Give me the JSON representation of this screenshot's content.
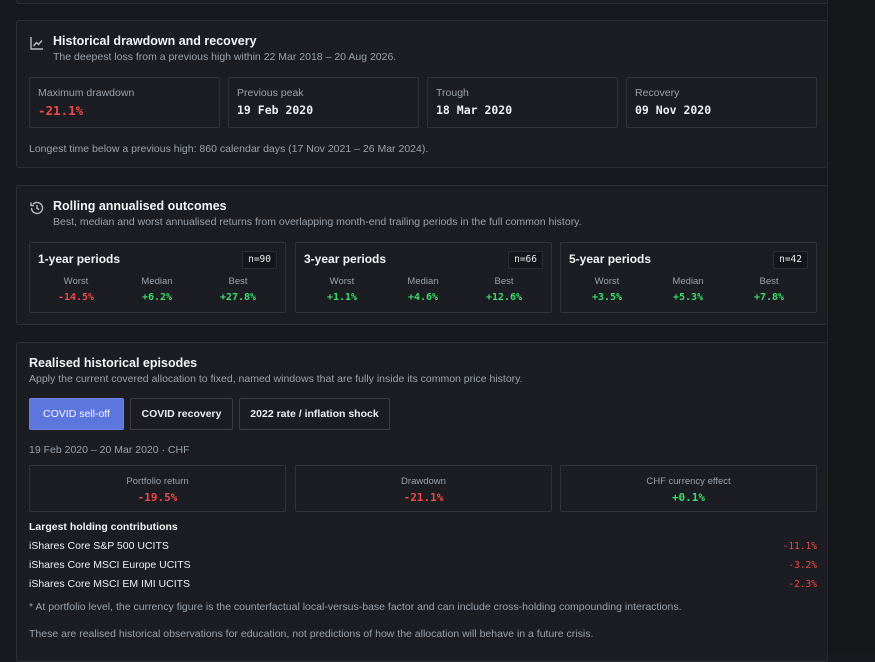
{
  "drawdown": {
    "title": "Historical drawdown and recovery",
    "subtitle": "The deepest loss from a previous high within 22 Mar 2018 – 20 Aug 2026.",
    "stats": [
      {
        "label": "Maximum drawdown",
        "value": "-21.1%"
      },
      {
        "label": "Previous peak",
        "value": "19 Feb 2020"
      },
      {
        "label": "Trough",
        "value": "18 Mar 2020"
      },
      {
        "label": "Recovery",
        "value": "09 Nov 2020"
      }
    ],
    "note": "Longest time below a previous high: 860 calendar days (17 Nov 2021 – 26 Mar 2024)."
  },
  "rolling": {
    "title": "Rolling annualised outcomes",
    "subtitle": "Best, median and worst annualised returns from overlapping month-end trailing periods in the full common history.",
    "col_labels": {
      "worst": "Worst",
      "median": "Median",
      "best": "Best"
    },
    "periods": [
      {
        "title": "1-year periods",
        "n": "n=90",
        "worst": "-14.5%",
        "median": "+6.2%",
        "best": "+27.8%"
      },
      {
        "title": "3-year periods",
        "n": "n=66",
        "worst": "+1.1%",
        "median": "+4.6%",
        "best": "+12.6%"
      },
      {
        "title": "5-year periods",
        "n": "n=42",
        "worst": "+3.5%",
        "median": "+5.3%",
        "best": "+7.8%"
      }
    ]
  },
  "episodes": {
    "title": "Realised historical episodes",
    "subtitle": "Apply the current covered allocation to fixed, named windows that are fully inside its common price history.",
    "buttons": [
      {
        "label": "COVID sell-off",
        "active": true
      },
      {
        "label": "COVID recovery",
        "active": false
      },
      {
        "label": "2022 rate / inflation shock",
        "active": false
      }
    ],
    "meta": "19 Feb 2020 – 20 Mar 2020 · CHF",
    "metrics": [
      {
        "label": "Portfolio return",
        "value": "-19.5%"
      },
      {
        "label": "Drawdown",
        "value": "-21.1%"
      },
      {
        "label": "CHF currency effect",
        "value": "+0.1%"
      }
    ],
    "contrib_heading": "Largest holding contributions",
    "contributions": [
      {
        "name": "iShares Core S&P 500 UCITS",
        "value": "-11.1%"
      },
      {
        "name": "iShares Core MSCI Europe UCITS",
        "value": "-3.2%"
      },
      {
        "name": "iShares Core MSCI EM IMI UCITS",
        "value": "-2.3%"
      }
    ],
    "footnote": "* At portfolio level, the currency figure is the counterfactual local-versus-base factor and can include cross-holding compounding interactions.",
    "disclaimer": "These are realised historical observations for education, not predictions of how the allocation will behave in a future crisis."
  },
  "colors": {
    "accent": "#5d76dd",
    "negative": "#f04848",
    "positive": "#3ddc6c",
    "background": "#17191e"
  },
  "icons": {
    "drawdown": "line-chart-icon",
    "rolling": "history-icon"
  }
}
